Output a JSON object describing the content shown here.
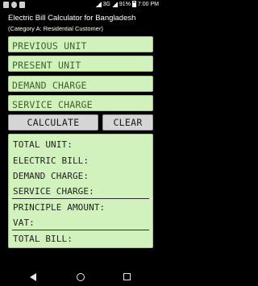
{
  "status_bar": {
    "network": "3G",
    "battery": "91%",
    "time": "7:00 PM"
  },
  "header": {
    "title": "Electric Bill Calculator for Bangladesh",
    "subtitle": "(Category A: Residential Customer)"
  },
  "inputs": {
    "previous_unit_placeholder": "PREVIOUS UNIT",
    "present_unit_placeholder": "PRESENT UNIT",
    "demand_charge_placeholder": "DEMAND CHARGE",
    "service_charge_placeholder": "SERVICE CHARGE"
  },
  "buttons": {
    "calculate_label": "CALCULATE",
    "clear_label": "CLEAR"
  },
  "results": {
    "total_unit_label": "TOTAL UNIT:",
    "electric_bill_label": "ELECTRIC BILL:",
    "demand_charge_label": "DEMAND CHARGE:",
    "service_charge_label": "SERVICE CHARGE:",
    "principle_amount_label": "PRINCIPLE AMOUNT:",
    "vat_label": "VAT:",
    "total_bill_label": "TOTAL BILL:"
  },
  "colors": {
    "field_background": "#d2f2bd",
    "field_border": "#a6c98f",
    "button_background": "#d6d6d6",
    "app_background": "#000000"
  }
}
